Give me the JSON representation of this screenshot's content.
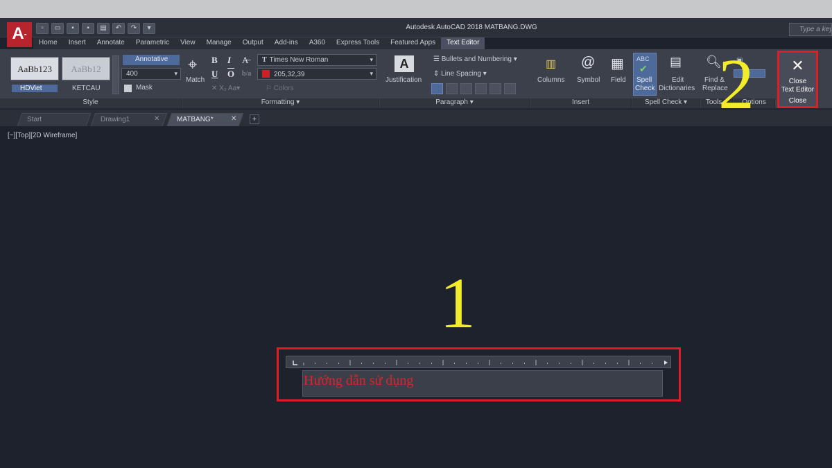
{
  "window": {
    "title": "Autodesk AutoCAD 2018    MATBANG.DWG",
    "search_placeholder": "Type a keyword"
  },
  "app": {
    "logo_letter": "A",
    "logo_suffix": "-"
  },
  "menu": [
    "Home",
    "Insert",
    "Annotate",
    "Parametric",
    "View",
    "Manage",
    "Output",
    "Add-ins",
    "A360",
    "Express Tools",
    "Featured Apps",
    "Text Editor"
  ],
  "ribbon": {
    "style": {
      "sample_1": "AaBb123",
      "sample_2": "AaBb12",
      "style_1_name": "HDViet",
      "style_2_name": "KETCAU",
      "annotative": "Annotative",
      "height": "400",
      "mask": "Mask",
      "panel": "Style"
    },
    "formatting": {
      "match": "Match",
      "font": "Times New Roman",
      "color": "205,32,39",
      "color_hex": "#cd2027",
      "colors": "Colors",
      "panel": "Formatting"
    },
    "paragraph": {
      "justification": "Justification",
      "bullets": "Bullets and Numbering",
      "line_spacing": "Line Spacing",
      "panel": "Paragraph"
    },
    "insert": {
      "columns": "Columns",
      "symbol": "Symbol",
      "field": "Field",
      "panel": "Insert"
    },
    "spell_check": {
      "spell_line1": "Spell",
      "spell_line2": "Check",
      "edit_line1": "Edit",
      "edit_line2": "Dictionaries",
      "panel": "Spell Check"
    },
    "tools": {
      "find_line1": "Find &",
      "find_line2": "Replace",
      "panel": "Tools"
    },
    "options": {
      "panel": "Options"
    },
    "close": {
      "label_line1": "Close",
      "label_line2": "Text Editor",
      "panel": "Close"
    }
  },
  "doc_tabs": [
    "Start",
    "Drawing1",
    "MATBANG*"
  ],
  "viewport": {
    "label": "[−][Top][2D Wireframe]"
  },
  "editor": {
    "text": "Hướng dẫn sử dụng"
  },
  "annotations": {
    "marker_1": "1",
    "marker_2": "2"
  },
  "colors": {
    "highlight": "#e01c24",
    "marker": "#f3ec2a",
    "canvas": "#1e222c"
  }
}
